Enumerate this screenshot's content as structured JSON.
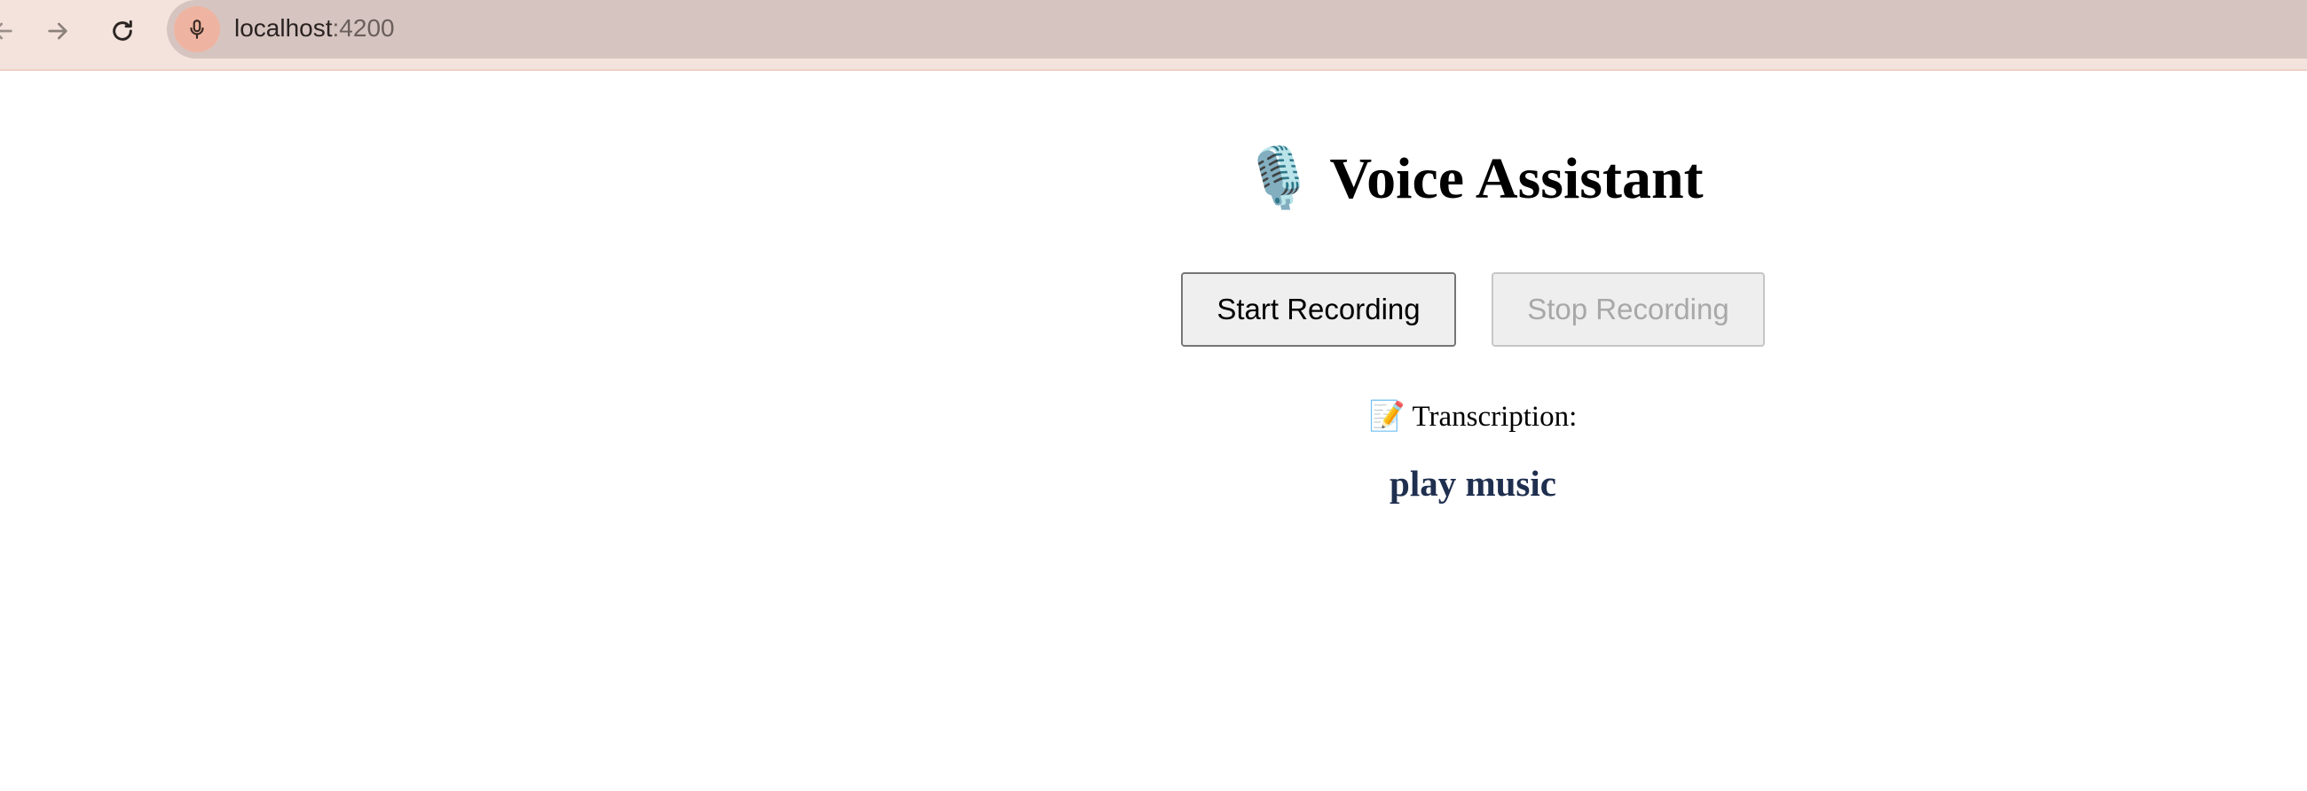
{
  "browser": {
    "url_host": "localhost",
    "url_port": ":4200",
    "icons": {
      "back": "arrow-left-icon",
      "forward": "arrow-right-icon",
      "reload": "reload-icon",
      "mic_indicator": "microphone-icon"
    },
    "accent_color": "#efb4a1"
  },
  "app": {
    "title_emoji": "🎙️",
    "title": "Voice Assistant",
    "start_button_label": "Start Recording",
    "stop_button_label": "Stop Recording",
    "stop_button_disabled": true,
    "transcription_emoji": "📝",
    "transcription_label": "Transcription:",
    "transcription_text": "play music",
    "transcription_color": "#1f2f4f"
  }
}
